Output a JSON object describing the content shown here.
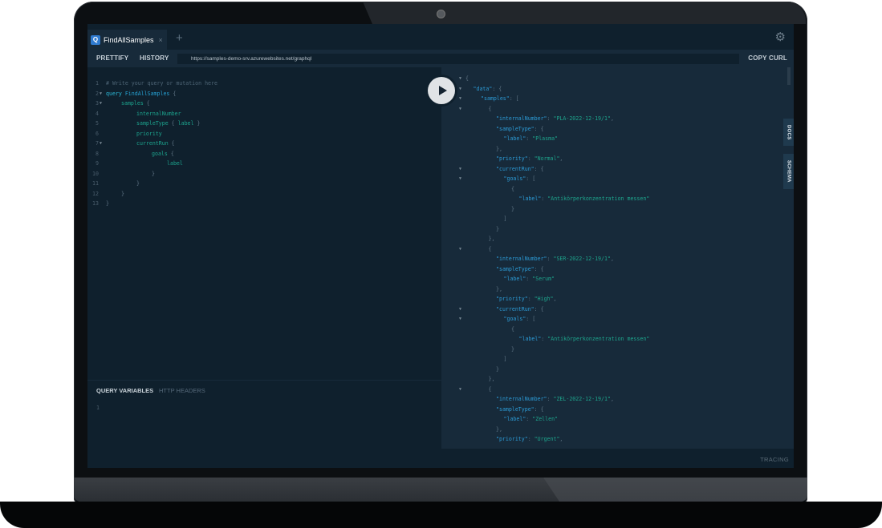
{
  "tab": {
    "title": "FindAllSamples",
    "logo": "Q",
    "close": "×"
  },
  "tab_add": "+",
  "toolbar": {
    "prettify": "PRETTIFY",
    "history": "HISTORY",
    "url": "https://samples-demo-srv.azurewebsites.net/graphql",
    "copy_curl": "COPY CURL"
  },
  "editor": {
    "lines": [
      {
        "n": "1",
        "fold": false,
        "indent": 0,
        "parts": [
          [
            "comment",
            "# Write your query or mutation here"
          ]
        ]
      },
      {
        "n": "2",
        "fold": true,
        "indent": 0,
        "parts": [
          [
            "kw",
            "query "
          ],
          [
            "def",
            "FindAllSamples "
          ],
          [
            "punct",
            "{"
          ]
        ]
      },
      {
        "n": "3",
        "fold": true,
        "indent": 1,
        "parts": [
          [
            "field",
            "samples "
          ],
          [
            "punct",
            "{"
          ]
        ]
      },
      {
        "n": "4",
        "fold": false,
        "indent": 2,
        "parts": [
          [
            "field",
            "internalNumber"
          ]
        ]
      },
      {
        "n": "5",
        "fold": false,
        "indent": 2,
        "parts": [
          [
            "field",
            "sampleType "
          ],
          [
            "punct",
            "{ "
          ],
          [
            "field",
            "label "
          ],
          [
            "punct",
            "}"
          ]
        ]
      },
      {
        "n": "6",
        "fold": false,
        "indent": 2,
        "parts": [
          [
            "field",
            "priority"
          ]
        ]
      },
      {
        "n": "7",
        "fold": true,
        "indent": 2,
        "parts": [
          [
            "field",
            "currentRun "
          ],
          [
            "punct",
            "{"
          ]
        ]
      },
      {
        "n": "8",
        "fold": false,
        "indent": 3,
        "parts": [
          [
            "field",
            "goals "
          ],
          [
            "punct",
            "{"
          ]
        ]
      },
      {
        "n": "9",
        "fold": false,
        "indent": 4,
        "parts": [
          [
            "field",
            "label"
          ]
        ]
      },
      {
        "n": "10",
        "fold": false,
        "indent": 3,
        "parts": [
          [
            "punct",
            "}"
          ]
        ]
      },
      {
        "n": "11",
        "fold": false,
        "indent": 2,
        "parts": [
          [
            "punct",
            "}"
          ]
        ]
      },
      {
        "n": "12",
        "fold": false,
        "indent": 1,
        "parts": [
          [
            "punct",
            "}"
          ]
        ]
      },
      {
        "n": "13",
        "fold": false,
        "indent": 0,
        "parts": [
          [
            "punct",
            "}"
          ]
        ]
      }
    ]
  },
  "vars": {
    "query_variables": "QUERY VARIABLES",
    "http_headers": "HTTP HEADERS",
    "line": "1"
  },
  "result": {
    "lines": [
      {
        "fold": true,
        "indent": 0,
        "parts": [
          [
            "punct",
            "{"
          ]
        ]
      },
      {
        "fold": true,
        "indent": 1,
        "parts": [
          [
            "key",
            "\"data\""
          ],
          [
            "punct",
            ": {"
          ]
        ]
      },
      {
        "fold": true,
        "indent": 2,
        "parts": [
          [
            "key",
            "\"samples\""
          ],
          [
            "punct",
            ": ["
          ]
        ]
      },
      {
        "fold": true,
        "indent": 3,
        "parts": [
          [
            "punct",
            "{"
          ]
        ]
      },
      {
        "fold": false,
        "indent": 4,
        "parts": [
          [
            "key",
            "\"internalNumber\""
          ],
          [
            "punct",
            ": "
          ],
          [
            "str",
            "\"PLA-2022-12-19/1\""
          ],
          [
            "punct",
            ","
          ]
        ]
      },
      {
        "fold": false,
        "indent": 4,
        "parts": [
          [
            "key",
            "\"sampleType\""
          ],
          [
            "punct",
            ": {"
          ]
        ]
      },
      {
        "fold": false,
        "indent": 5,
        "parts": [
          [
            "key",
            "\"label\""
          ],
          [
            "punct",
            ": "
          ],
          [
            "str",
            "\"Plasma\""
          ]
        ]
      },
      {
        "fold": false,
        "indent": 4,
        "parts": [
          [
            "punct",
            "},"
          ]
        ]
      },
      {
        "fold": false,
        "indent": 4,
        "parts": [
          [
            "key",
            "\"priority\""
          ],
          [
            "punct",
            ": "
          ],
          [
            "str",
            "\"Normal\""
          ],
          [
            "punct",
            ","
          ]
        ]
      },
      {
        "fold": true,
        "indent": 4,
        "parts": [
          [
            "key",
            "\"currentRun\""
          ],
          [
            "punct",
            ": {"
          ]
        ]
      },
      {
        "fold": true,
        "indent": 5,
        "parts": [
          [
            "key",
            "\"goals\""
          ],
          [
            "punct",
            ": ["
          ]
        ]
      },
      {
        "fold": false,
        "indent": 6,
        "parts": [
          [
            "punct",
            "{"
          ]
        ]
      },
      {
        "fold": false,
        "indent": 7,
        "parts": [
          [
            "key",
            "\"label\""
          ],
          [
            "punct",
            ": "
          ],
          [
            "str",
            "\"Antikörperkonzentration messen\""
          ]
        ]
      },
      {
        "fold": false,
        "indent": 6,
        "parts": [
          [
            "punct",
            "}"
          ]
        ]
      },
      {
        "fold": false,
        "indent": 5,
        "parts": [
          [
            "punct",
            "]"
          ]
        ]
      },
      {
        "fold": false,
        "indent": 4,
        "parts": [
          [
            "punct",
            "}"
          ]
        ]
      },
      {
        "fold": false,
        "indent": 3,
        "parts": [
          [
            "punct",
            "},"
          ]
        ]
      },
      {
        "fold": true,
        "indent": 3,
        "parts": [
          [
            "punct",
            "{"
          ]
        ]
      },
      {
        "fold": false,
        "indent": 4,
        "parts": [
          [
            "key",
            "\"internalNumber\""
          ],
          [
            "punct",
            ": "
          ],
          [
            "str",
            "\"SER-2022-12-19/1\""
          ],
          [
            "punct",
            ","
          ]
        ]
      },
      {
        "fold": false,
        "indent": 4,
        "parts": [
          [
            "key",
            "\"sampleType\""
          ],
          [
            "punct",
            ": {"
          ]
        ]
      },
      {
        "fold": false,
        "indent": 5,
        "parts": [
          [
            "key",
            "\"label\""
          ],
          [
            "punct",
            ": "
          ],
          [
            "str",
            "\"Serum\""
          ]
        ]
      },
      {
        "fold": false,
        "indent": 4,
        "parts": [
          [
            "punct",
            "},"
          ]
        ]
      },
      {
        "fold": false,
        "indent": 4,
        "parts": [
          [
            "key",
            "\"priority\""
          ],
          [
            "punct",
            ": "
          ],
          [
            "str",
            "\"High\""
          ],
          [
            "punct",
            ","
          ]
        ]
      },
      {
        "fold": true,
        "indent": 4,
        "parts": [
          [
            "key",
            "\"currentRun\""
          ],
          [
            "punct",
            ": {"
          ]
        ]
      },
      {
        "fold": true,
        "indent": 5,
        "parts": [
          [
            "key",
            "\"goals\""
          ],
          [
            "punct",
            ": ["
          ]
        ]
      },
      {
        "fold": false,
        "indent": 6,
        "parts": [
          [
            "punct",
            "{"
          ]
        ]
      },
      {
        "fold": false,
        "indent": 7,
        "parts": [
          [
            "key",
            "\"label\""
          ],
          [
            "punct",
            ": "
          ],
          [
            "str",
            "\"Antikörperkonzentration messen\""
          ]
        ]
      },
      {
        "fold": false,
        "indent": 6,
        "parts": [
          [
            "punct",
            "}"
          ]
        ]
      },
      {
        "fold": false,
        "indent": 5,
        "parts": [
          [
            "punct",
            "]"
          ]
        ]
      },
      {
        "fold": false,
        "indent": 4,
        "parts": [
          [
            "punct",
            "}"
          ]
        ]
      },
      {
        "fold": false,
        "indent": 3,
        "parts": [
          [
            "punct",
            "},"
          ]
        ]
      },
      {
        "fold": true,
        "indent": 3,
        "parts": [
          [
            "punct",
            "{"
          ]
        ]
      },
      {
        "fold": false,
        "indent": 4,
        "parts": [
          [
            "key",
            "\"internalNumber\""
          ],
          [
            "punct",
            ": "
          ],
          [
            "str",
            "\"ZEL-2022-12-19/1\""
          ],
          [
            "punct",
            ","
          ]
        ]
      },
      {
        "fold": false,
        "indent": 4,
        "parts": [
          [
            "key",
            "\"sampleType\""
          ],
          [
            "punct",
            ": {"
          ]
        ]
      },
      {
        "fold": false,
        "indent": 5,
        "parts": [
          [
            "key",
            "\"label\""
          ],
          [
            "punct",
            ": "
          ],
          [
            "str",
            "\"Zellen\""
          ]
        ]
      },
      {
        "fold": false,
        "indent": 4,
        "parts": [
          [
            "punct",
            "},"
          ]
        ]
      },
      {
        "fold": false,
        "indent": 4,
        "parts": [
          [
            "key",
            "\"priority\""
          ],
          [
            "punct",
            ": "
          ],
          [
            "str",
            "\"Urgent\""
          ],
          [
            "punct",
            ","
          ]
        ]
      }
    ]
  },
  "side_tabs": {
    "docs": "DOCS",
    "schema": "SCHEMA"
  },
  "footer": {
    "tracing": "TRACING"
  },
  "icons": {
    "settings": "gear-icon",
    "play": "play-icon",
    "fold": "triangle-down-icon"
  }
}
